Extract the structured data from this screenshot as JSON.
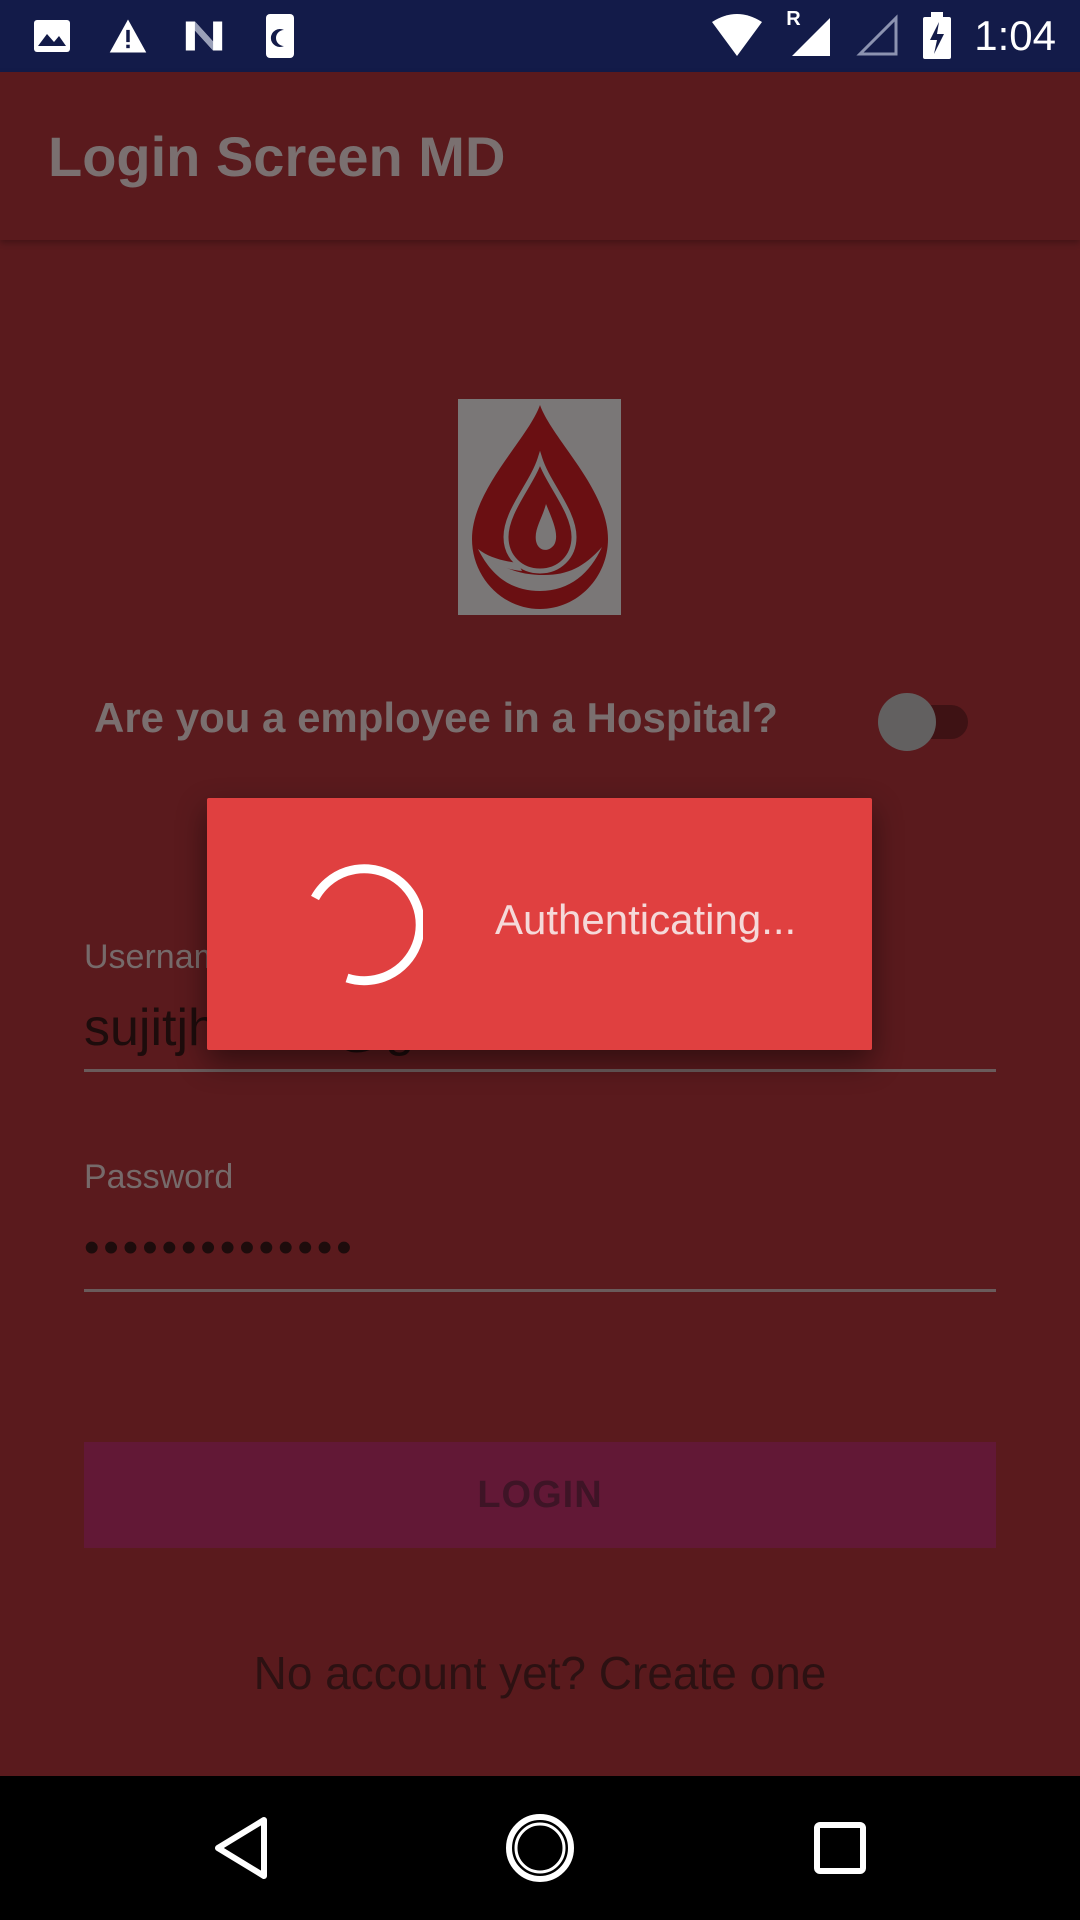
{
  "status_bar": {
    "time": "1:04",
    "roaming_label": "R",
    "icons": [
      "image-notification-icon",
      "warning-icon",
      "n-logo-icon",
      "moon-icon",
      "wifi-icon",
      "cell-signal-roaming-icon",
      "cell-signal-empty-icon",
      "battery-charging-icon"
    ]
  },
  "app_bar": {
    "title": "Login Screen MD"
  },
  "logo": {
    "icon": "blood-drop-hand-icon"
  },
  "hospital_toggle": {
    "question": "Are you a employee in a Hospital?",
    "state": "off"
  },
  "username": {
    "label": "Username",
    "value": "sujitjha000@gmail.com"
  },
  "password": {
    "label": "Password",
    "value": "••••••••••••••"
  },
  "login_button": {
    "label": "LOGIN"
  },
  "signup": {
    "text": "No account yet? Create one"
  },
  "dialog": {
    "message": "Authenticating..."
  },
  "nav_bar": {
    "buttons": [
      "back-icon",
      "home-icon",
      "recents-icon"
    ]
  },
  "colors": {
    "status_bar": "#131b49",
    "background": "#5a1a1d",
    "dialog": "#e04040",
    "login_button": "#621836"
  }
}
